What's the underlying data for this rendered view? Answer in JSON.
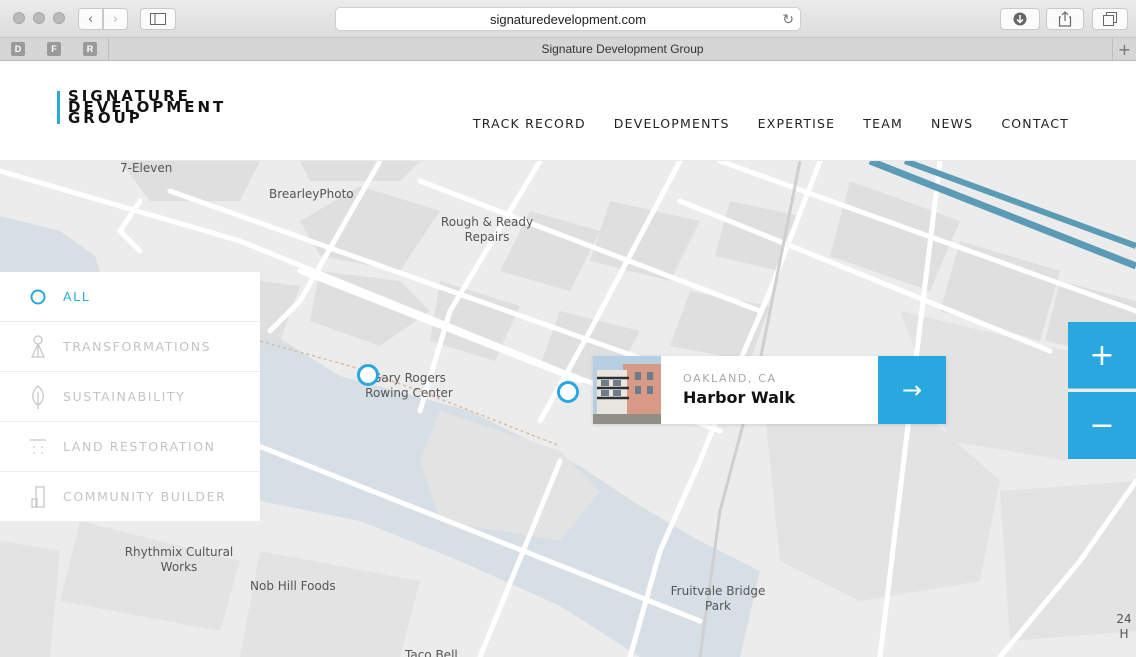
{
  "browser": {
    "url": "signaturedevelopment.com",
    "tab_title": "Signature Development Group",
    "favicons": [
      "D",
      "F",
      "R"
    ]
  },
  "logo": {
    "lines": [
      "SIGNATURE",
      "DEVELOPMENT",
      "GROUP"
    ],
    "accent": "#2aa8d8"
  },
  "nav": {
    "items": [
      "TRACK RECORD",
      "DEVELOPMENTS",
      "EXPERTISE",
      "TEAM",
      "NEWS",
      "CONTACT"
    ]
  },
  "filters": {
    "items": [
      {
        "label": "ALL",
        "icon": "circle-icon",
        "active": true
      },
      {
        "label": "TRANSFORMATIONS",
        "icon": "transformation-icon",
        "active": false
      },
      {
        "label": "SUSTAINABILITY",
        "icon": "leaf-icon",
        "active": false
      },
      {
        "label": "LAND RESTORATION",
        "icon": "land-icon",
        "active": false
      },
      {
        "label": "COMMUNITY BUILDER",
        "icon": "building-icon",
        "active": false
      }
    ]
  },
  "map": {
    "labels": {
      "seven_eleven": "7-Eleven",
      "brearley": "BrearleyPhoto",
      "rough_ready_1": "Rough & Ready",
      "rough_ready_2": "Repairs",
      "gary_1": "Gary Rogers",
      "gary_2": "Rowing Center",
      "rhythmix_1": "Rhythmix Cultural",
      "rhythmix_2": "Works",
      "nobhill": "Nob Hill Foods",
      "fruitvale_1": "Fruitvale Bridge",
      "fruitvale_2": "Park",
      "tacobell": "Taco Bell",
      "edge_24": "24 H"
    }
  },
  "card": {
    "location": "OAKLAND, CA",
    "title": "Harbor Walk",
    "arrow": "→"
  },
  "zoom": {
    "in": "+",
    "out": "−"
  },
  "colors": {
    "accent": "#29a8e0",
    "water": "#d4dde3",
    "map_bg": "#ececec",
    "freeway": "#5b9bb5"
  }
}
